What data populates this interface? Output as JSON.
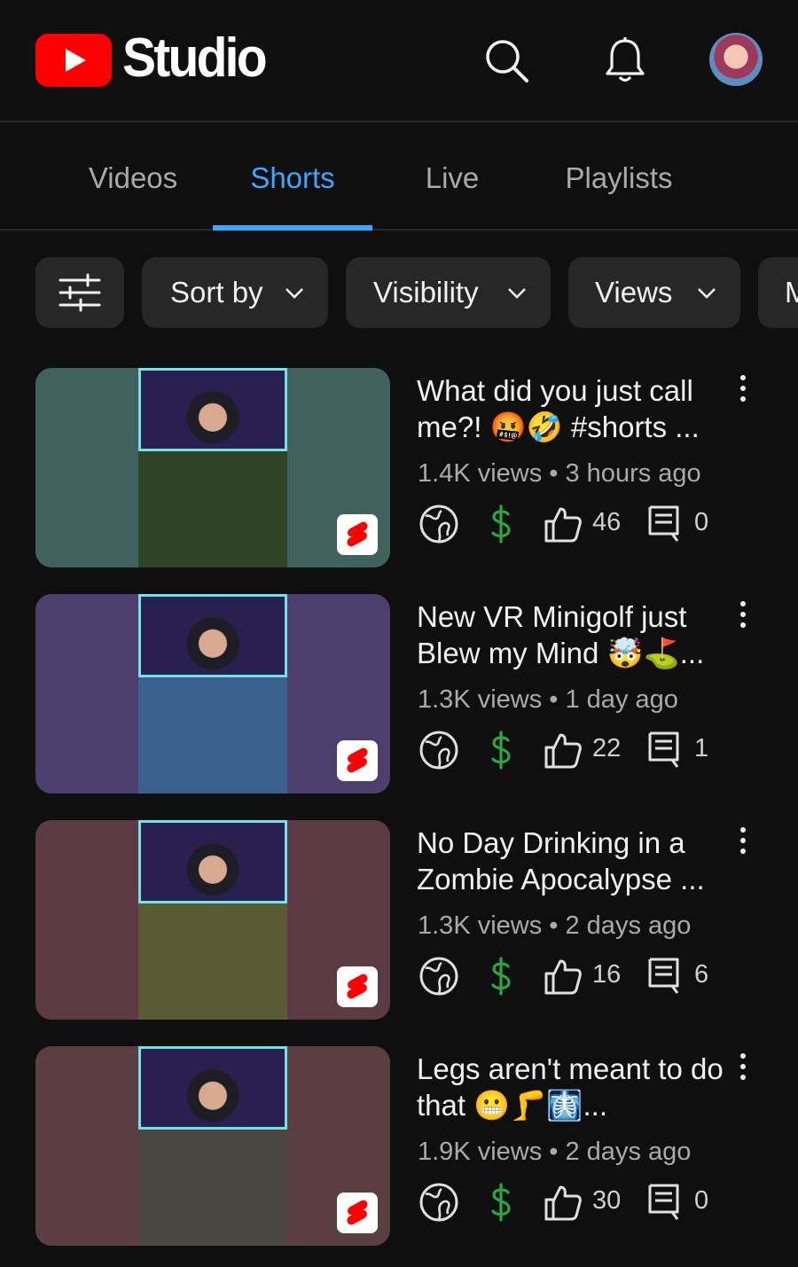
{
  "header": {
    "brand": "Studio",
    "logo_icon": "youtube-play-icon",
    "search_icon": "search-icon",
    "bell_icon": "bell-icon",
    "avatar": "avatar"
  },
  "tabs": [
    {
      "label": "Videos",
      "active": false
    },
    {
      "label": "Shorts",
      "active": true
    },
    {
      "label": "Live",
      "active": false
    },
    {
      "label": "Playlists",
      "active": false
    }
  ],
  "filters": {
    "filter_icon": "tune-icon",
    "chips": [
      {
        "label": "Sort by"
      },
      {
        "label": "Visibility"
      },
      {
        "label": "Views"
      },
      {
        "label": "M"
      }
    ]
  },
  "colors": {
    "accent": "#3ea6ff",
    "monetization": "#2ba640",
    "background": "#0f0f0f"
  },
  "videos": [
    {
      "title": "What did you just call me?! 🤬🤣 #shorts ...",
      "meta": "1.4K views • 3 hours ago",
      "likes": "46",
      "comments": "0",
      "thumb_bg": "#41615c",
      "game_bg": "#2f4424"
    },
    {
      "title": "New VR Minigolf just Blew my Mind 🤯⛳...",
      "meta": "1.3K views • 1 day ago",
      "likes": "22",
      "comments": "1",
      "thumb_bg": "#4c3f6e",
      "game_bg": "#3b5f8f"
    },
    {
      "title": "No Day Drinking in a Zombie Apocalypse ...",
      "meta": "1.3K views • 2 days ago",
      "likes": "16",
      "comments": "6",
      "thumb_bg": "#5b3a44",
      "game_bg": "#5a5a34"
    },
    {
      "title": "Legs aren't meant to do that 😬🦵🩻...",
      "meta": "1.9K views • 2 days ago",
      "likes": "30",
      "comments": "0",
      "thumb_bg": "#5b3e42",
      "game_bg": "#4a4640"
    }
  ]
}
